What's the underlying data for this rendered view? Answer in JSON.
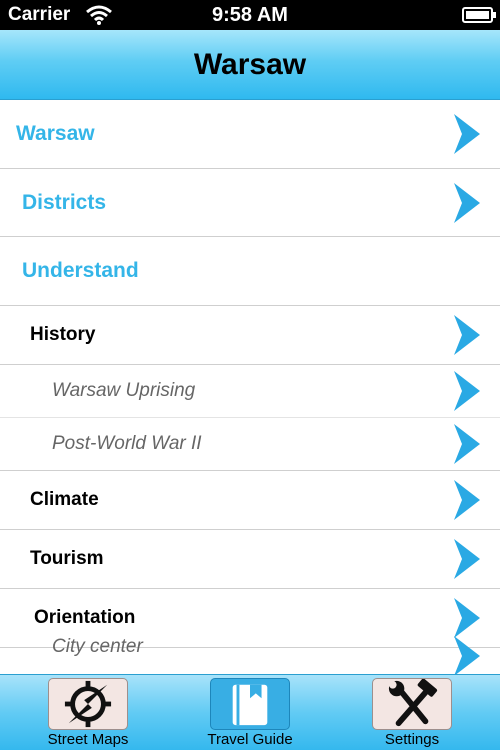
{
  "status_bar": {
    "carrier": "Carrier",
    "time": "9:58 AM"
  },
  "nav": {
    "title": "Warsaw"
  },
  "list": [
    {
      "label": "Warsaw",
      "level": 0
    },
    {
      "label": "Districts",
      "level": 0
    },
    {
      "label": "Understand",
      "level": 0,
      "no_chevron": true
    },
    {
      "label": "History",
      "level": 1
    },
    {
      "label": "Warsaw Uprising",
      "level": 2
    },
    {
      "label": "Post-World War II",
      "level": 2
    },
    {
      "label": "Climate",
      "level": 1
    },
    {
      "label": "Tourism",
      "level": 1
    },
    {
      "label": "Orientation",
      "level": 1
    },
    {
      "label": "City center",
      "level": 2
    }
  ],
  "tabs": [
    {
      "label": "Street Maps",
      "icon": "compass-icon",
      "selected": false
    },
    {
      "label": "Travel Guide",
      "icon": "book-icon",
      "selected": true
    },
    {
      "label": "Settings",
      "icon": "tools-icon",
      "selected": false
    }
  ],
  "colors": {
    "accent": "#34b5e8",
    "chevron": "#2aa9e4",
    "nav_top": "#a6e6fb",
    "nav_bottom": "#2fb9ef"
  }
}
